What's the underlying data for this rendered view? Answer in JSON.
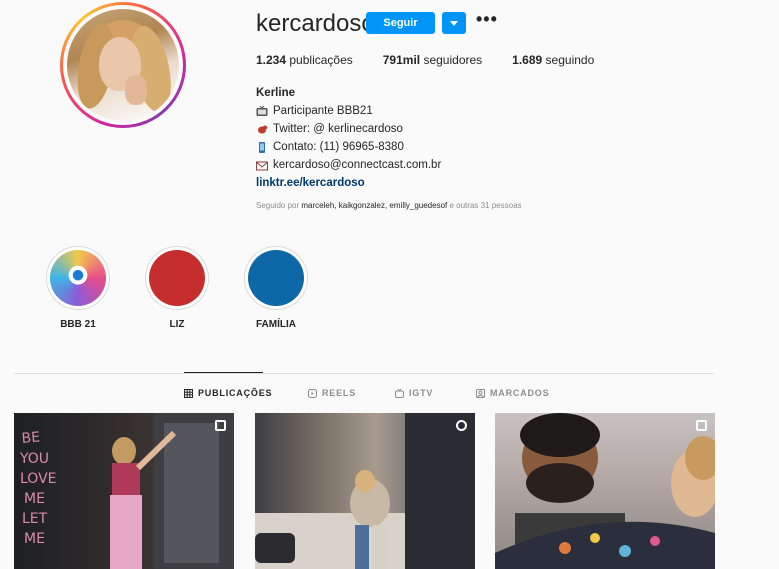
{
  "profile": {
    "username": "kercardoso",
    "follow_label": "Seguir",
    "more_label": "•••",
    "stats": {
      "posts_count": "1.234",
      "posts_label": "publicações",
      "followers_count": "791mil",
      "followers_label": "seguidores",
      "following_count": "1.689",
      "following_label": "seguindo"
    },
    "bio": {
      "name": "Kerline",
      "line1": "Participante BBB21",
      "line2": "Twitter: @ kerlinecardoso",
      "line3": "Contato: (11) 96965-8380",
      "line4": "kercardoso@connectcast.com.br",
      "link": "linktr.ee/kercardoso"
    },
    "followed_by": {
      "prefix": "Seguido por",
      "users": "marceleh, kaikgonzalez, emilly_guedesof",
      "suffix": "e outras 31 pessoas"
    }
  },
  "highlights": [
    {
      "label": "BBB 21",
      "color": "#f2c94c"
    },
    {
      "label": "LIZ",
      "color": "#c62d2d"
    },
    {
      "label": "FAMÍLIA",
      "color": "#0e67a6"
    }
  ],
  "tabs": [
    {
      "label": "PUBLICAÇÕES",
      "icon": "grid-icon",
      "active": true
    },
    {
      "label": "REELS",
      "icon": "reels-icon",
      "active": false
    },
    {
      "label": "IGTV",
      "icon": "igtv-icon",
      "active": false
    },
    {
      "label": "MARCADOS",
      "icon": "tagged-icon",
      "active": false
    }
  ],
  "colors": {
    "accent": "#0095f6",
    "link": "#00376b",
    "muted": "#8e8e8e"
  }
}
